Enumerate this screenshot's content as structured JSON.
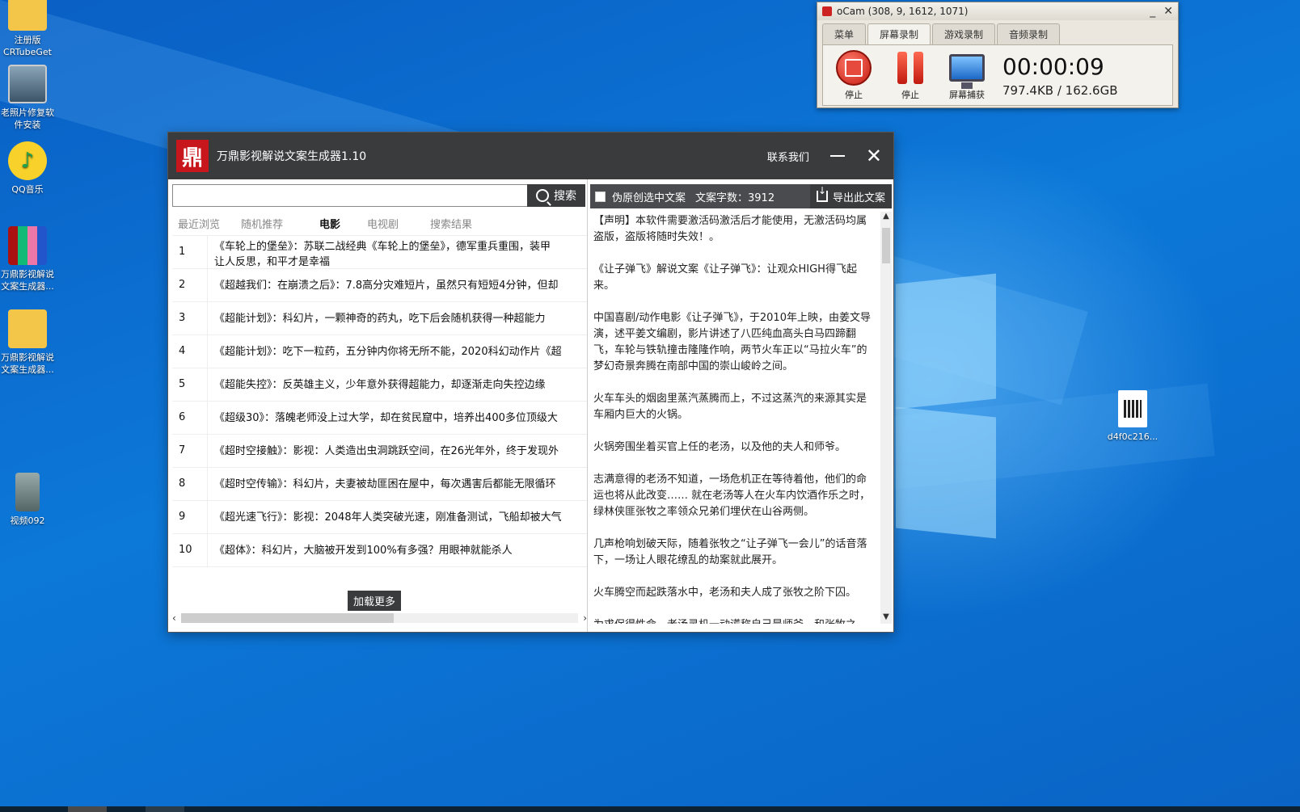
{
  "desktop": {
    "icons": [
      {
        "label_line1": "注册版",
        "label_line2": "CRTubeGet"
      },
      {
        "label_line1": "老照片修复软",
        "label_line2": "件安装"
      },
      {
        "label_line1": "QQ音乐",
        "label_line2": ""
      },
      {
        "label_line1": "万鼎影视解说",
        "label_line2": "文案生成器..."
      },
      {
        "label_line1": "万鼎影视解说",
        "label_line2": "文案生成器..."
      },
      {
        "label_line1": "视频092",
        "label_line2": ""
      },
      {
        "label_line1": "d4f0c216...",
        "label_line2": ""
      }
    ]
  },
  "ocam": {
    "title": "oCam (308, 9, 1612, 1071)",
    "tabs": [
      "菜单",
      "屏幕录制",
      "游戏录制",
      "音频录制"
    ],
    "buttons": [
      "停止",
      "停止",
      "屏幕捕获"
    ],
    "time": "00:00:09",
    "size": "797.4KB / 162.6GB"
  },
  "app": {
    "logo_char": "鼎",
    "title": "万鼎影视解说文案生成器1.10",
    "contact": "联系我们",
    "close": "✕",
    "search": {
      "button": "搜索",
      "value": ""
    },
    "tabs": [
      "最近浏览",
      "随机推荐",
      "电影",
      "电视剧",
      "搜索结果"
    ],
    "list": [
      {
        "num": "1",
        "line1": "《车轮上的堡垒》：苏联二战经典《车轮上的堡垒》，德军重兵重围，装甲",
        "line2": "让人反思，和平才是幸福"
      },
      {
        "num": "2",
        "line1": "《超越我们：在崩溃之后》：7.8高分灾难短片，虽然只有短短4分钟，但却",
        "line2": ""
      },
      {
        "num": "3",
        "line1": "《超能计划》：科幻片，一颗神奇的药丸，吃下后会随机获得一种超能力",
        "line2": ""
      },
      {
        "num": "4",
        "line1": "《超能计划》：吃下一粒药，五分钟内你将无所不能，2020科幻动作片《超",
        "line2": ""
      },
      {
        "num": "5",
        "line1": "《超能失控》：反英雄主义，少年意外获得超能力，却逐渐走向失控边缘",
        "line2": ""
      },
      {
        "num": "6",
        "line1": "《超级30》：落魄老师没上过大学，却在贫民窟中，培养出400多位顶级大",
        "line2": ""
      },
      {
        "num": "7",
        "line1": "《超时空接触》：影视：人类造出虫洞跳跃空间，在26光年外，终于发现外",
        "line2": ""
      },
      {
        "num": "8",
        "line1": "《超时空传输》：科幻片，夫妻被劫匪困在屋中，每次遇害后都能无限循环",
        "line2": ""
      },
      {
        "num": "9",
        "line1": "《超光速飞行》：影视：2048年人类突破光速，刚准备测试，飞船却被大气",
        "line2": ""
      },
      {
        "num": "10",
        "line1": "《超体》：科幻片，大脑被开发到100%有多强？用眼神就能杀人",
        "line2": ""
      }
    ],
    "load_more": "加载更多",
    "right": {
      "checkbox_label": "伪原创选中文案",
      "count_label": "文案字数：3912",
      "export": "导出此文案",
      "paragraphs": [
        "【声明】本软件需要激活码激活后才能使用，无激活码均属盗版，盗版将随时失效！。",
        "《让子弹飞》解说文案《让子弹飞》：让观众HIGH得飞起来。",
        "中国喜剧/动作电影《让子弹飞》，于2010年上映，由姜文导演，述平姜文编剧，影片讲述了八匹纯血高头白马四蹄翻飞，车轮与铁轨撞击隆隆作响，两节火车正以“马拉火车”的梦幻奇景奔腾在南部中国的崇山峻岭之间。",
        "火车车头的烟囱里蒸汽蒸腾而上，不过这蒸汽的来源其实是车厢内巨大的火锅。",
        "火锅旁围坐着买官上任的老汤，以及他的夫人和师爷。",
        "志满意得的老汤不知道，一场危机正在等待着他，他们的命运也将从此改变……        就在老汤等人在火车内饮酒作乐之时，绿林侠匪张牧之率领众兄弟们埋伏在山谷两侧。",
        "几声枪响划破天际，随着张牧之“让子弹飞一会儿”的话音落下，一场让人眼花缭乱的劫案就此展开。",
        "火车腾空而起跌落水中，老汤和夫人成了张牧之阶下囚。",
        "为求保得性命，老汤灵机一动谎称自己是师爷，和张牧之"
      ]
    }
  }
}
